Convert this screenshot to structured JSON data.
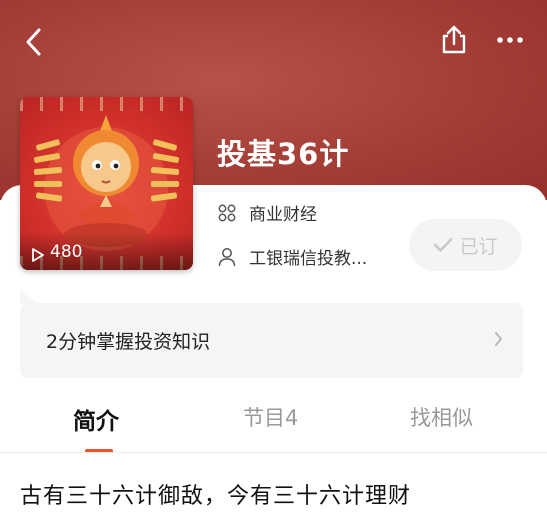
{
  "header": {
    "back_icon": "back-chevron-icon",
    "share_icon": "share-icon",
    "more_icon": "more-dots-icon"
  },
  "album": {
    "title": "投基36计",
    "cover_icon": "cover-art-image",
    "play_count": "480",
    "category": "商业财经",
    "author": "工银瑞信投教...",
    "subscribe_label": "已订",
    "subscribed": true
  },
  "summary": {
    "text": "2分钟掌握投资知识"
  },
  "tabs": [
    {
      "label": "简介",
      "active": true
    },
    {
      "label": "节目4",
      "active": false
    },
    {
      "label": "找相似",
      "active": false
    }
  ],
  "intro": {
    "text": "古有三十六计御敌，今有三十六计理财"
  },
  "colors": {
    "hero_bg": "#a33d36",
    "accent": "#f0522c",
    "subscribe_bg": "#f4f4f4"
  }
}
